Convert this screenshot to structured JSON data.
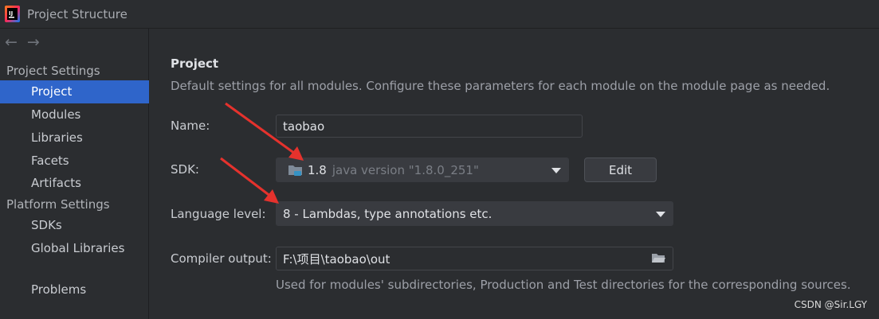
{
  "window": {
    "title": "Project Structure"
  },
  "sidebar": {
    "back_icon": "arrow-left-icon",
    "forward_icon": "arrow-right-icon",
    "groups": [
      {
        "header": "Project Settings",
        "items": [
          {
            "label": "Project",
            "selected": true
          },
          {
            "label": "Modules"
          },
          {
            "label": "Libraries"
          },
          {
            "label": "Facets"
          },
          {
            "label": "Artifacts"
          }
        ]
      },
      {
        "header": "Platform Settings",
        "items": [
          {
            "label": "SDKs"
          },
          {
            "label": "Global Libraries"
          }
        ]
      }
    ],
    "problems_label": "Problems"
  },
  "main": {
    "title": "Project",
    "description": "Default settings for all modules. Configure these parameters for each module on the module page as needed.",
    "name": {
      "label": "Name:",
      "value": "taobao"
    },
    "sdk": {
      "label": "SDK:",
      "selected_name": "1.8",
      "selected_detail": "java version \"1.8.0_251\"",
      "edit_label": "Edit"
    },
    "language_level": {
      "label": "Language level:",
      "value": "8 - Lambdas, type annotations etc."
    },
    "compiler_output": {
      "label": "Compiler output:",
      "value": "F:\\项目\\taobao\\out",
      "hint": "Used for modules' subdirectories, Production and Test directories for the corresponding sources."
    }
  },
  "watermark": "CSDN @Sir.LGY",
  "colors": {
    "accent_selection": "#2f65ca",
    "annotation_arrow": "#e5322d"
  }
}
